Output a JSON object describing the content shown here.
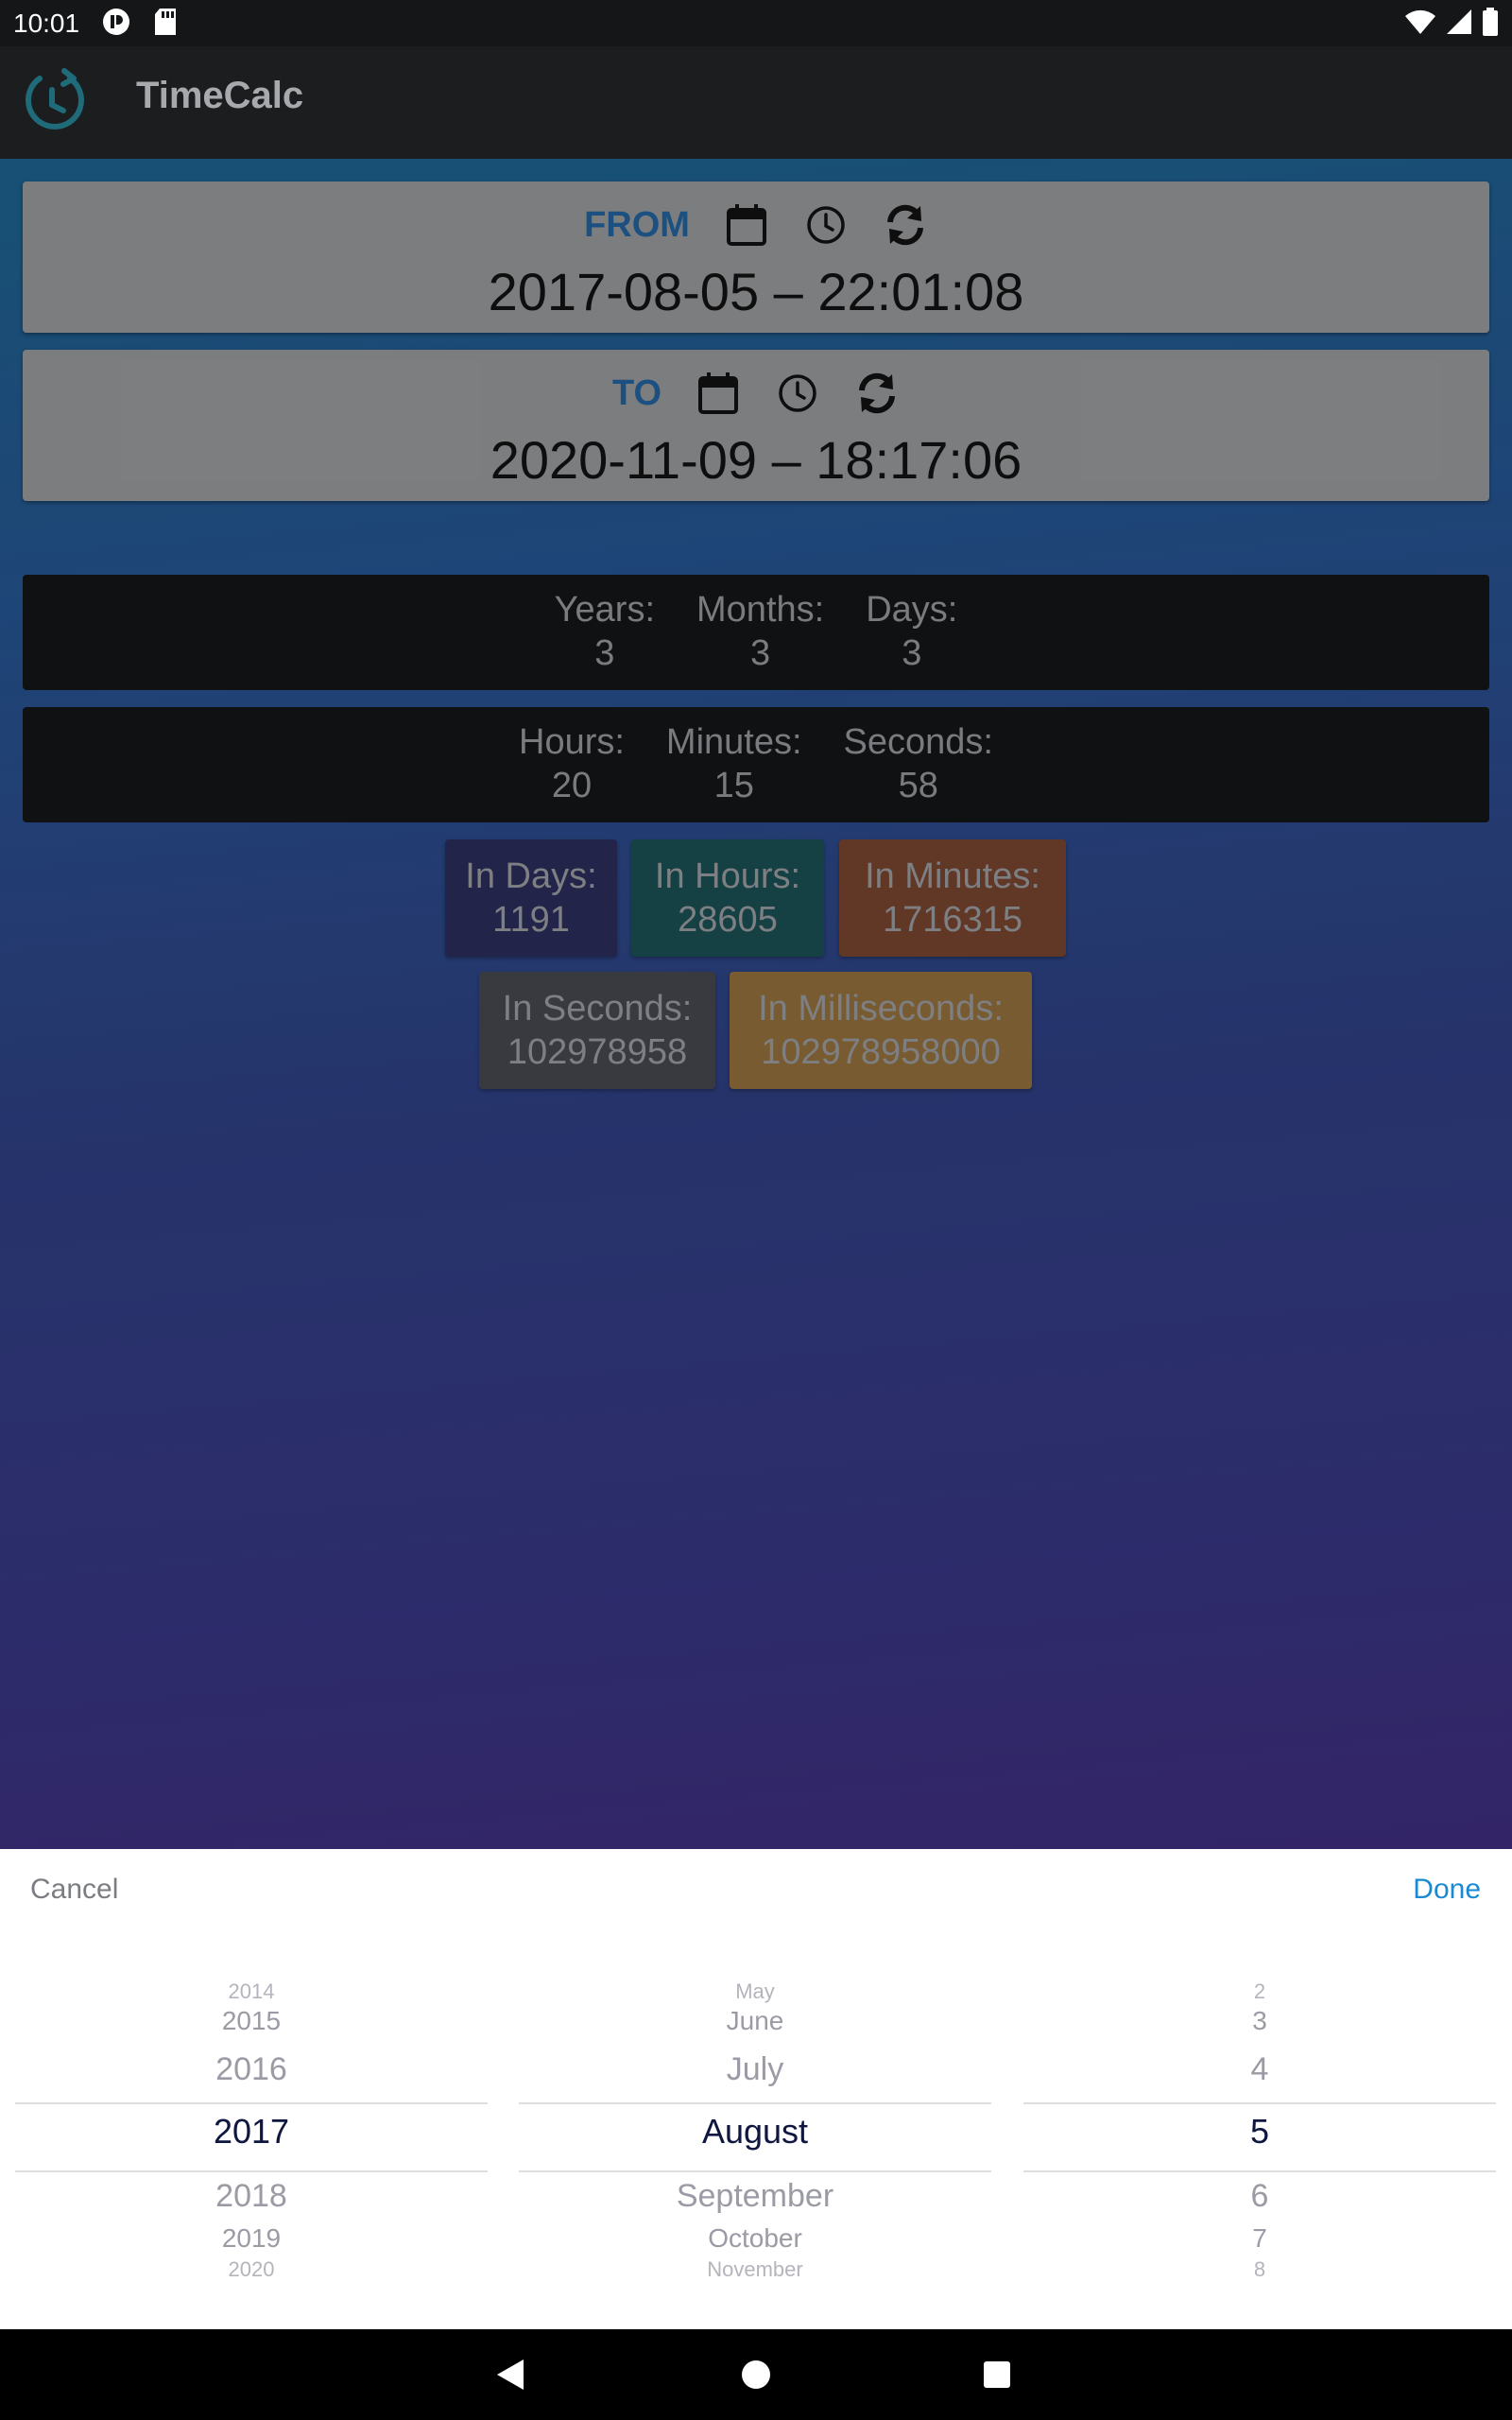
{
  "status_bar": {
    "time": "10:01",
    "left_icons": [
      "notification-app-icon",
      "sd-card-icon"
    ],
    "right_icons": [
      "wifi-icon",
      "cellular-signal-icon",
      "battery-icon"
    ]
  },
  "app_bar": {
    "title": "TimeCalc",
    "logo_icon": "clock-arrow-icon"
  },
  "from_card": {
    "label": "FROM",
    "value": "2017-08-05 – 22:01:08",
    "icons": [
      "calendar-icon",
      "clock-icon",
      "refresh-icon"
    ]
  },
  "to_card": {
    "label": "TO",
    "value": "2020-11-09 – 18:17:06",
    "icons": [
      "calendar-icon",
      "clock-icon",
      "refresh-icon"
    ]
  },
  "difference": {
    "date_parts": [
      {
        "label": "Years:",
        "value": "3"
      },
      {
        "label": "Months:",
        "value": "3"
      },
      {
        "label": "Days:",
        "value": "3"
      }
    ],
    "time_parts": [
      {
        "label": "Hours:",
        "value": "20"
      },
      {
        "label": "Minutes:",
        "value": "15"
      },
      {
        "label": "Seconds:",
        "value": "58"
      }
    ]
  },
  "totals": [
    {
      "label": "In Days:",
      "value": "1191",
      "color": "#272a55"
    },
    {
      "label": "In Hours:",
      "value": "28605",
      "color": "#1a4a4e"
    },
    {
      "label": "In Minutes:",
      "value": "1716315",
      "color": "#6f3f2b"
    },
    {
      "label": "In Seconds:",
      "value": "102978958",
      "color": "#414249"
    },
    {
      "label": "In Milliseconds:",
      "value": "102978958000",
      "color": "#8a6838"
    }
  ],
  "picker": {
    "cancel_label": "Cancel",
    "done_label": "Done",
    "years": {
      "above": [
        "2014",
        "2015",
        "2016"
      ],
      "selected": "2017",
      "below": [
        "2018",
        "2019",
        "2020"
      ]
    },
    "months": {
      "above": [
        "May",
        "June",
        "July"
      ],
      "selected": "August",
      "below": [
        "September",
        "October",
        "November"
      ]
    },
    "days": {
      "above": [
        "2",
        "3",
        "4"
      ],
      "selected": "5",
      "below": [
        "6",
        "7",
        "8"
      ]
    }
  },
  "nav_bar": {
    "icons": [
      "back-icon",
      "home-icon",
      "recents-icon"
    ]
  },
  "colors": {
    "label_blue": "#1f5c93",
    "done_blue": "#1b8ad3",
    "sheet_bg": "#ffffff"
  }
}
